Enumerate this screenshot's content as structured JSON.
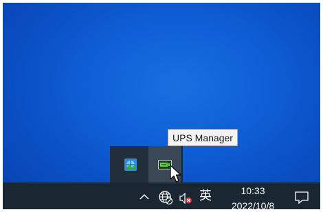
{
  "tooltip": {
    "text": "UPS Manager"
  },
  "tray_overflow": {
    "items": [
      {
        "icon": "app-globe-icon"
      },
      {
        "icon": "ups-battery-icon",
        "tooltip": "UPS Manager",
        "hovered": true
      }
    ]
  },
  "taskbar": {
    "tray": {
      "chevron_icon": "chevron-up-icon",
      "network_icon": "network-globe-icon",
      "volume_icon": "volume-muted-icon",
      "ime_label": "英"
    },
    "clock": {
      "time": "10:33",
      "date": "2022/10/8"
    },
    "notification_icon": "action-center-icon"
  },
  "colors": {
    "desktop": "#0f5fd6",
    "taskbar": "#1b2633",
    "flyout": "#222e3c",
    "hover": "#3a4757",
    "tooltip_bg": "#f3f3f3"
  }
}
